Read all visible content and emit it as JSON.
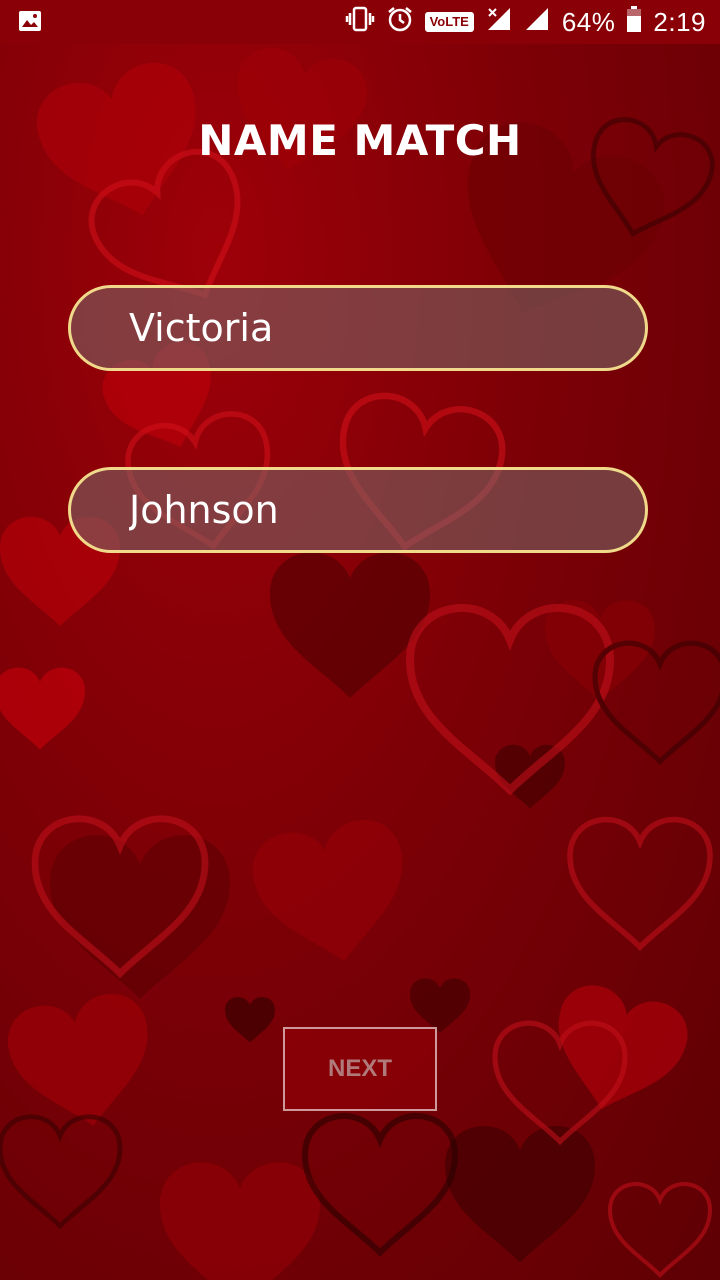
{
  "status_bar": {
    "battery_percent": "64%",
    "time": "2:19",
    "volte_label": "VoLTE",
    "icons": [
      "gallery-icon",
      "vibrate-icon",
      "alarm-icon",
      "volte-icon",
      "signal-icon",
      "signal-icon",
      "battery-icon"
    ]
  },
  "screen": {
    "title": "NAME MATCH",
    "first_name_value": "Victoria",
    "second_name_value": "Johnson",
    "next_label": "NEXT"
  },
  "colors": {
    "background": "#7a0006",
    "status_bar": "#8a0007",
    "field_border": "#f0d98a",
    "title_text": "#ffffff",
    "next_text": "#b07a7a"
  }
}
